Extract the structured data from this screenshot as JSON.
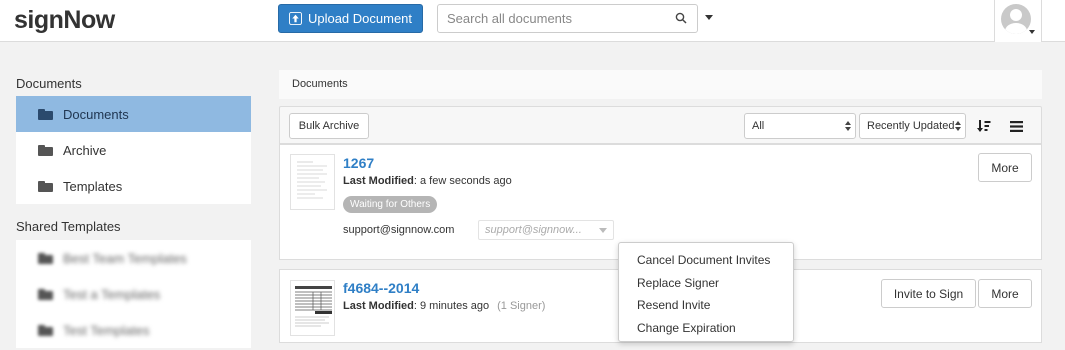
{
  "header": {
    "logo": "signNow",
    "upload_label": "Upload Document",
    "search_placeholder": "Search all documents"
  },
  "sidebar": {
    "documents_heading": "Documents",
    "items": [
      {
        "label": "Documents",
        "active": true
      },
      {
        "label": "Archive",
        "active": false
      },
      {
        "label": "Templates",
        "active": false
      }
    ],
    "shared_heading": "Shared Templates",
    "shared_items": [
      {
        "label": "Best Team Templates"
      },
      {
        "label": "Test a Templates"
      },
      {
        "label": "Test Templates"
      }
    ]
  },
  "main": {
    "breadcrumb": "Documents",
    "toolbar": {
      "bulk_archive_label": "Bulk Archive",
      "filter_value": "All",
      "sort_value": "Recently Updated"
    },
    "documents": [
      {
        "title": "1267",
        "last_modified_label": "Last Modified",
        "last_modified_value": ": a few seconds ago",
        "status_badge": "Waiting for Others",
        "signer_email": "support@signnow.com",
        "signer_select": "support@signnow...",
        "more_label": "More"
      },
      {
        "title": "f4684--2014",
        "last_modified_label": "Last Modified",
        "last_modified_value": ": 9 minutes ago",
        "signer_count": "(1 Signer)",
        "invite_label": "Invite to Sign",
        "more_label": "More"
      }
    ],
    "more_menu": [
      "Cancel Document Invites",
      "Replace Signer",
      "Resend Invite",
      "Change Expiration"
    ]
  },
  "colors": {
    "brand_blue": "#2f7fc6",
    "active_sidebar": "#8fb9e1",
    "badge_gray": "#b5b5b5"
  }
}
